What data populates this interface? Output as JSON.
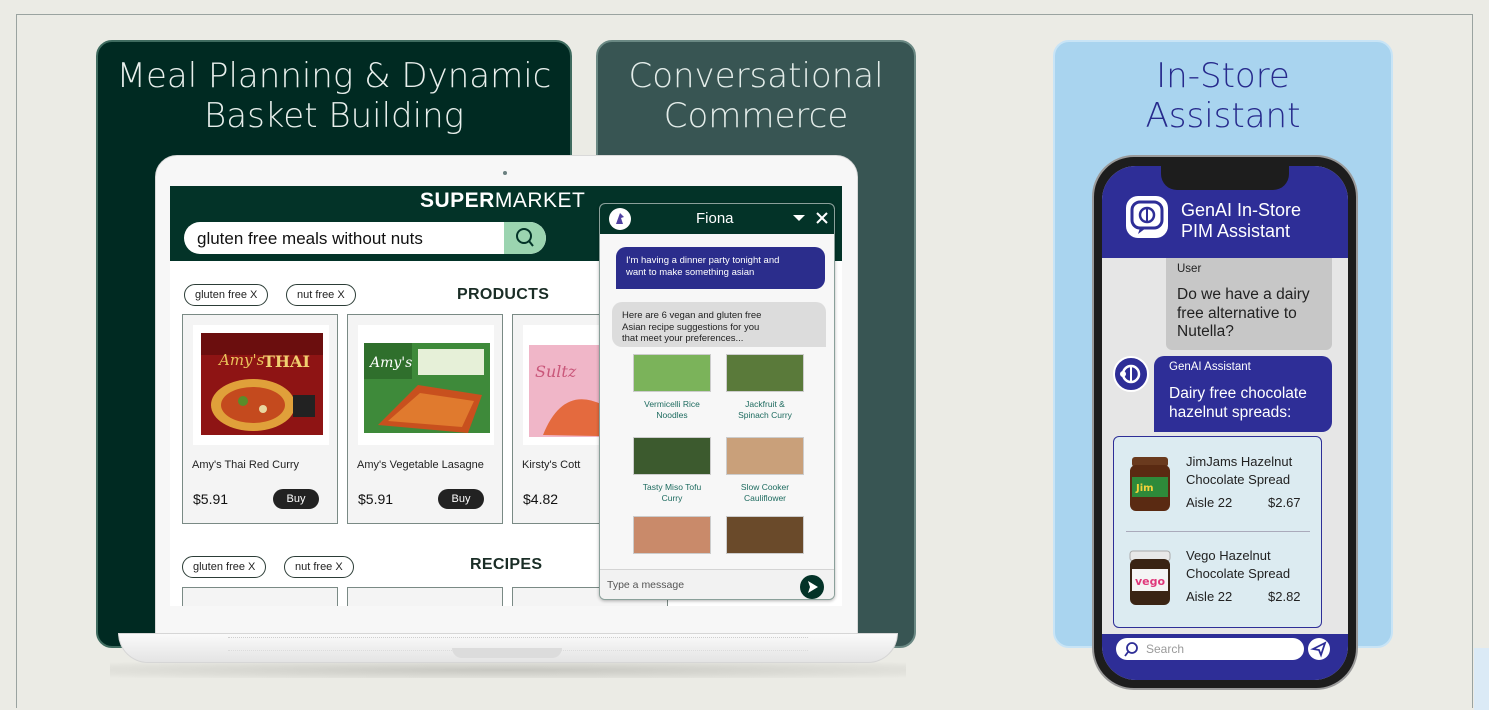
{
  "panels": {
    "meal": {
      "title": "Meal Planning & Dynamic\nBasket Building"
    },
    "conv": {
      "title": "Conversational\nCommerce"
    },
    "store": {
      "title": "In-Store\nAssistant"
    }
  },
  "store_site": {
    "brand_bold": "SUPER",
    "brand_light": "MARKET",
    "search_value": "gluten free meals without nuts",
    "filters": [
      "gluten free X",
      "nut free X"
    ],
    "products_heading": "PRODUCTS",
    "recipes_heading": "RECIPES",
    "products": [
      {
        "name": "Amy's Thai Red Curry",
        "price": "$5.91",
        "button": "Buy"
      },
      {
        "name": "Amy's Vegetable Lasagne",
        "price": "$5.91",
        "button": "Buy"
      },
      {
        "name": "Kirsty's Cott",
        "price": "$4.82"
      }
    ]
  },
  "chat": {
    "agent_name": "Fiona",
    "user_msg": "I'm having a dinner party tonight and\nwant to make something asian",
    "bot_msg": "Here are 6 vegan and gluten free\nAsian recipe suggestions for you\nthat meet your preferences...",
    "recipes": [
      {
        "label": "Vermicelli Rice\nNoodles"
      },
      {
        "label": "Jackfruit &\nSpinach Curry"
      },
      {
        "label": "Tasty Miso Tofu\nCurry"
      },
      {
        "label": "Slow Cooker\nCauliflower"
      },
      {
        "label": ""
      },
      {
        "label": ""
      }
    ],
    "input_placeholder": "Type a message"
  },
  "phone": {
    "title": "GenAI In-Store\nPIM Assistant",
    "user_label": "User",
    "user_msg": "Do we have a dairy free alternative to Nutella?",
    "bot_label": "GenAI Assistant",
    "bot_msg": "Dairy free chocolate hazelnut spreads:",
    "results": [
      {
        "name": "JimJams Hazelnut\nChocolate Spread",
        "aisle": "Aisle 22",
        "price": "$2.67"
      },
      {
        "name": "Vego Hazelnut\nChocolate Spread",
        "aisle": "Aisle 22",
        "price": "$2.82"
      }
    ],
    "search_placeholder": "Search"
  },
  "colors": {
    "dark_green": "#002a22",
    "teal": "#385553",
    "light_blue": "#a9d4ef",
    "indigo": "#2e2e97"
  }
}
